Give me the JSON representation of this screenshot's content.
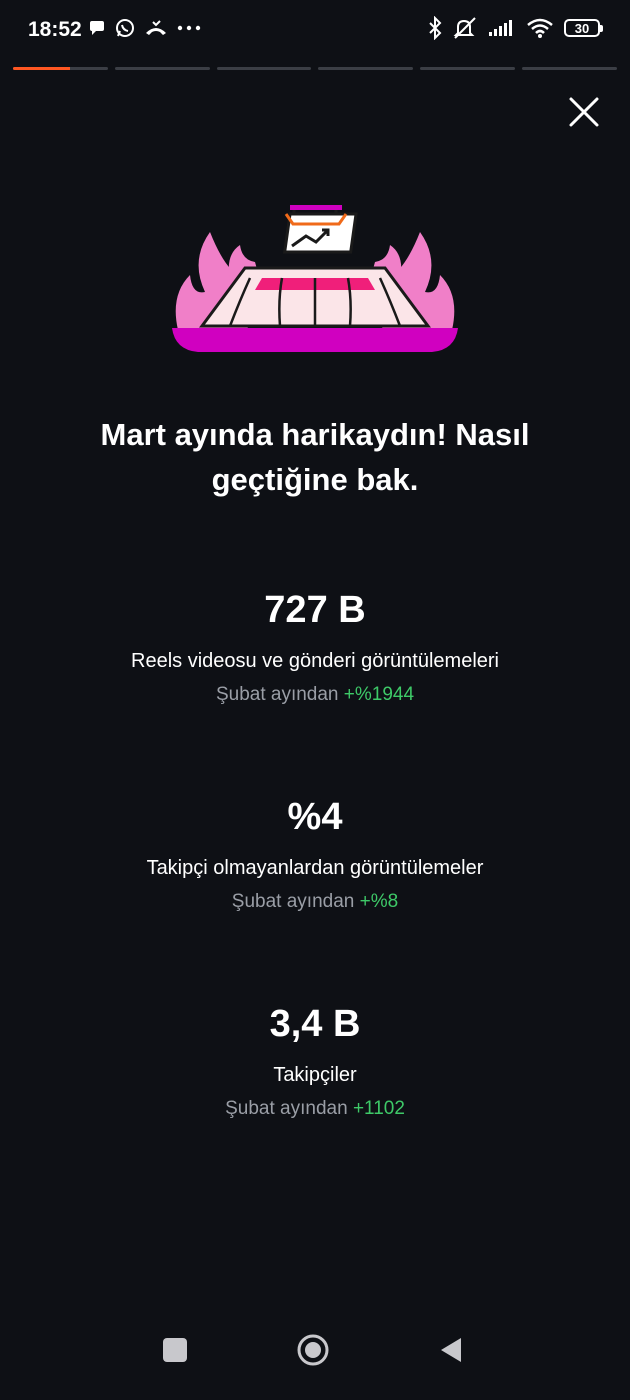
{
  "status_bar": {
    "time": "18:52",
    "battery_level": "30",
    "left_icons": [
      "chat-bubble-icon",
      "whatsapp-icon",
      "missed-call-icon",
      "more-dots-icon"
    ],
    "right_icons": [
      "bluetooth-icon",
      "mute-icon",
      "signal-icon",
      "wifi-icon",
      "battery-icon"
    ]
  },
  "story_progress": {
    "segments": [
      {
        "fill": 0.6
      },
      {
        "fill": 0
      },
      {
        "fill": 0
      },
      {
        "fill": 0
      },
      {
        "fill": 0
      },
      {
        "fill": 0
      }
    ],
    "accent_color": "#ff5722"
  },
  "headline": {
    "line1": "Mart ayında harikaydın! Nasıl",
    "line2": "geçtiğine bak."
  },
  "stats": [
    {
      "value": "727 B",
      "label": "Reels videosu ve gönderi görüntülemeleri",
      "change_prefix": "Şubat ayından ",
      "change_value": "+%1944"
    },
    {
      "value": "%4",
      "label": "Takipçi olmayanlardan görüntülemeler",
      "change_prefix": "Şubat ayından ",
      "change_value": "+%8"
    },
    {
      "value": "3,4 B",
      "label": "Takipçiler",
      "change_prefix": "Şubat ayından ",
      "change_value": "+1102"
    }
  ],
  "colors": {
    "background": "#0e1015",
    "positive_delta": "#3ec968",
    "muted_text": "#9a9ea6",
    "flame_pink": "#f07fc8",
    "base_magenta": "#d000c0"
  }
}
